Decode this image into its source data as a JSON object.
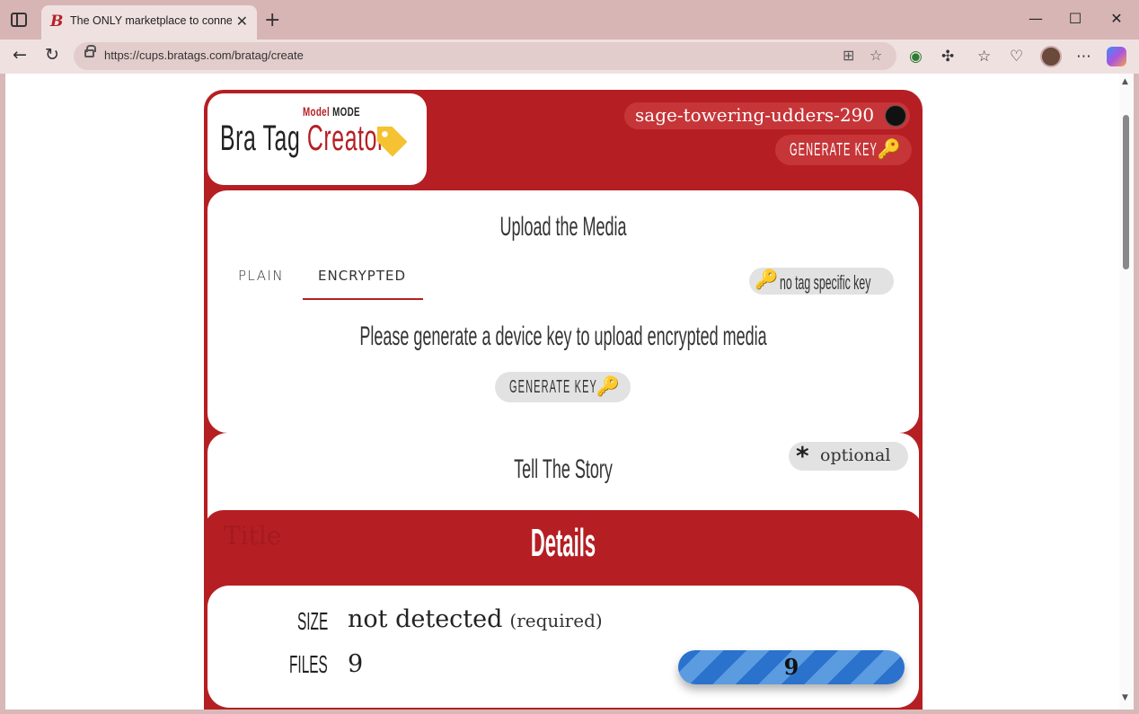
{
  "browser": {
    "tab_title": "The ONLY marketplace to connect",
    "tab_favicon": "B",
    "url": "https://cups.bratags.com/bratag/create",
    "icons": {
      "close_tab": "close-icon",
      "new_tab": "plus-icon",
      "back": "back-arrow-icon",
      "reload": "reload-icon"
    }
  },
  "app": {
    "logo": {
      "model": "Model",
      "mode": "MODE",
      "bra_tag": "Bra Tag",
      "creator": "Creator"
    },
    "username": "sage-towering-udders-290",
    "generate_key_label": "GENERATE KEY",
    "upload": {
      "title": "Upload the Media",
      "tabs": [
        "PLAIN",
        "ENCRYPTED"
      ],
      "active_tab": "ENCRYPTED",
      "no_tag_key_label": "no tag specific key",
      "message": "Please generate a device key to upload encrypted media",
      "generate_key_label": "GENERATE KEY"
    },
    "story": {
      "title": "Tell The Story",
      "optional_label": "optional",
      "field_placeholder": "Title"
    },
    "details": {
      "title": "Details",
      "size_label": "SIZE",
      "size_value": "not detected",
      "size_note": "(required)",
      "files_label": "FILES",
      "files_value": "9",
      "progress_value": "9"
    }
  },
  "colors": {
    "brand_red": "#b51f23",
    "pill_gray": "#e2e2e2",
    "progress_blue": "#2a72cc",
    "tag_yellow": "#f5c232"
  }
}
